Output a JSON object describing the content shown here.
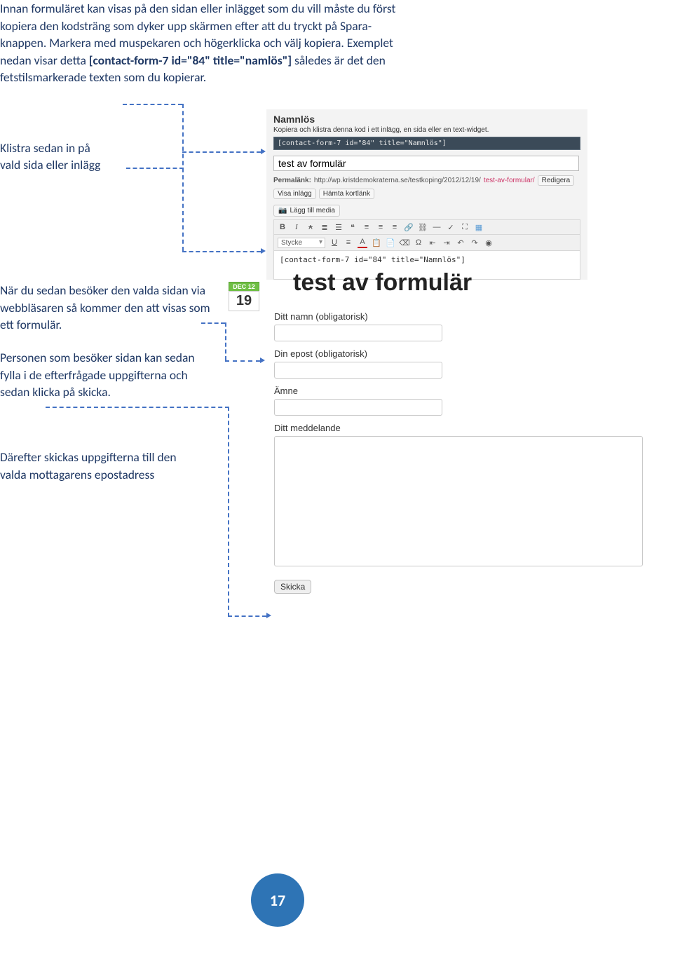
{
  "intro": {
    "p1a": "Innan formuläret kan visas på den sidan eller inlägget som du vill måste du först kopiera den kodsträng som dyker upp skärmen efter att du tryckt på Spara-knappen. Markera med muspekaren och högerklicka och välj kopiera. Exemplet nedan visar detta ",
    "p1b": "[contact-form-7 id=\"84\" title=\"namlös\"]",
    "p1c": " således är det den  fetstilsmarkerade texten som du kopierar."
  },
  "klistra": {
    "line1": "Klistra sedan in på",
    "line2": "vald sida eller inlägg"
  },
  "txt2": "När du sedan besöker den valda sidan via webbläsaren så kommer den att visas som ett formulär.",
  "txt3": "Personen som besöker sidan kan sedan fylla i de efterfrågade uppgifterna och sedan klicka på skicka.",
  "txt4": "Därefter skickas uppgifterna till den valda mottagarens epostadress",
  "editor": {
    "title": "Namnlös",
    "help": "Kopiera och klistra denna kod i ett inlägg, en sida eller en text-widget.",
    "code": "[contact-form-7 id=\"84\" title=\"Namnlös\"]",
    "postTitle": "test av formulär",
    "permalink": {
      "label": "Permalänk:",
      "url": "http://wp.kristdemokraterna.se/testkoping/2012/12/19/",
      "slug": "test-av-formular/",
      "edit": "Redigera",
      "view": "Visa inlägg",
      "short": "Hämta kortlänk"
    },
    "mediaBtn": "Lägg till media",
    "styleSel": "Stycke",
    "body": "[contact-form-7 id=\"84\" title=\"Namnlös\"]"
  },
  "front": {
    "month": "DEC 12",
    "day": "19",
    "title": "test av formulär",
    "lblName": "Ditt namn (obligatorisk)",
    "lblEmail": "Din epost (obligatorisk)",
    "lblSubject": "Ämne",
    "lblMessage": "Ditt meddelande",
    "submit": "Skicka"
  },
  "pagenum": "17"
}
